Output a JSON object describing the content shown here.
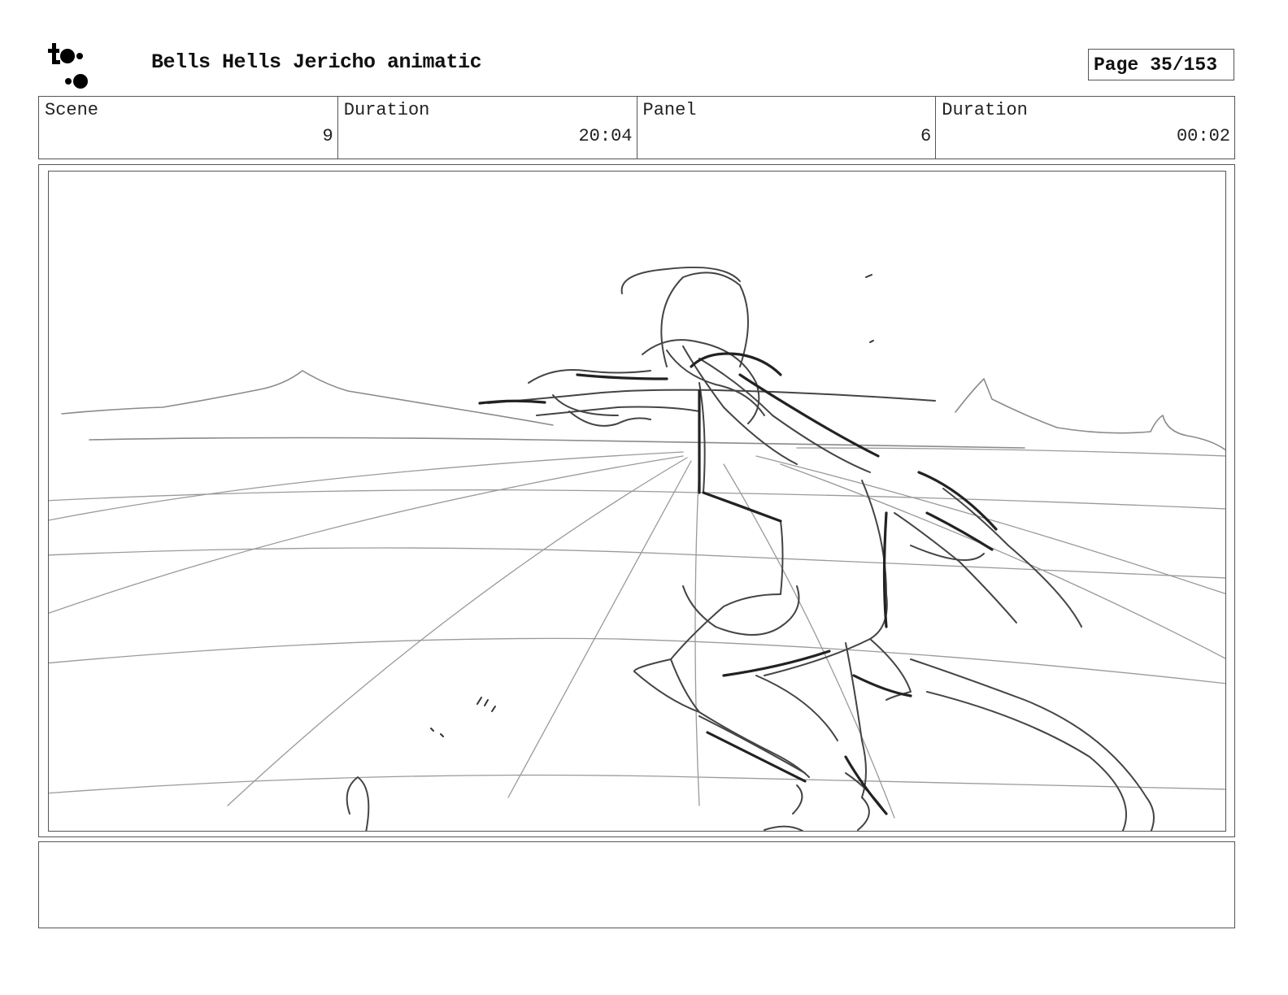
{
  "header": {
    "logo_text_top": "toon",
    "logo_text_bottom": "boom",
    "title": "Bells Hells Jericho animatic",
    "page_label": "Page",
    "page_value": "35/153"
  },
  "info": {
    "scene_label": "Scene",
    "scene_value": "9",
    "scene_duration_label": "Duration",
    "scene_duration_value": "20:04",
    "panel_label": "Panel",
    "panel_value": "6",
    "panel_duration_label": "Duration",
    "panel_duration_value": "00:02"
  },
  "notes": {
    "text": ""
  }
}
